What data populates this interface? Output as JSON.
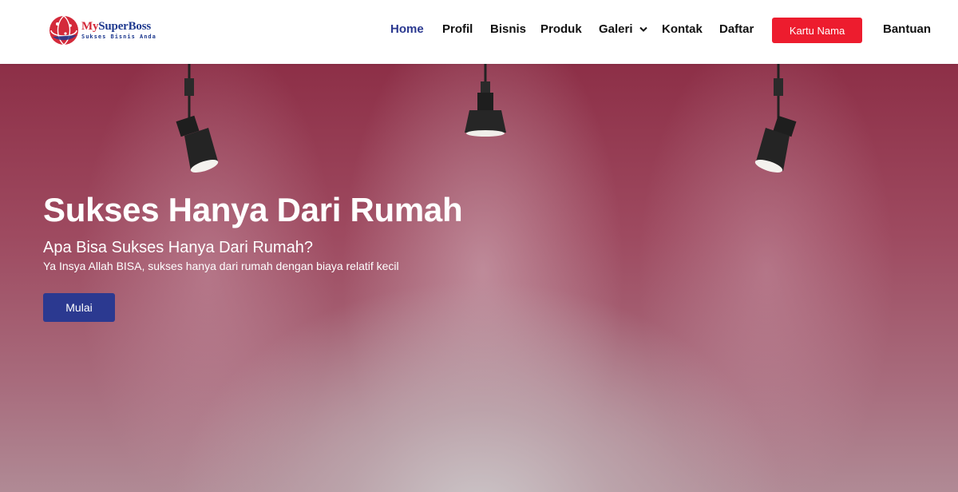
{
  "brand": {
    "name_part1": "My",
    "name_part2": "SuperBoss",
    "tagline": "Sukses Bisnis Anda",
    "colors": {
      "red": "#d42a3a",
      "blue": "#1f3a8f"
    }
  },
  "nav": {
    "items": [
      {
        "label": "Home",
        "active": true
      },
      {
        "label": "Profil"
      },
      {
        "label": "Bisnis"
      },
      {
        "label": "Produk"
      },
      {
        "label": "Galeri",
        "has_dropdown": true
      },
      {
        "label": "Kontak"
      },
      {
        "label": "Daftar"
      }
    ],
    "cta_label": "Kartu Nama",
    "help_label": "Bantuan",
    "colors": {
      "active": "#2b3990",
      "cta_bg": "#ed1c2e"
    }
  },
  "hero": {
    "title": "Sukses Hanya Dari Rumah",
    "subtitle": "Apa Bisa Sukses Hanya Dari Rumah?",
    "text": "Ya Insya Allah BISA, sukses hanya dari rumah dengan biaya relatif kecil",
    "button_label": "Mulai",
    "colors": {
      "button_bg": "#2b3990",
      "background": "#9e4a60"
    }
  }
}
